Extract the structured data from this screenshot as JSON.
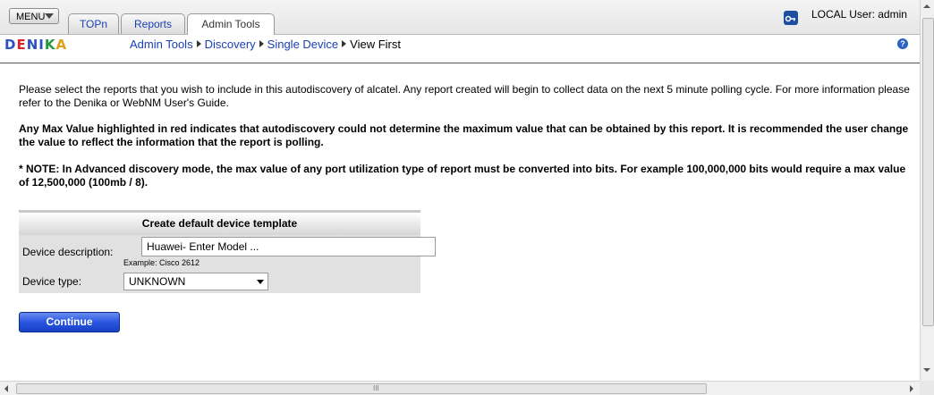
{
  "header": {
    "menu_label": "MENU",
    "tabs": [
      {
        "label": "TOPn"
      },
      {
        "label": "Reports"
      },
      {
        "label": "Admin Tools"
      }
    ],
    "user_label": "LOCAL User: admin",
    "lock_icon": "lock-icon"
  },
  "logo": {
    "letters": [
      "D",
      "E",
      "N",
      "I",
      "K",
      "A"
    ]
  },
  "breadcrumb": {
    "items": [
      "Admin Tools",
      "Discovery",
      "Single Device"
    ],
    "current": "View First",
    "help_icon": "?"
  },
  "content": {
    "para1": "Please select the reports that you wish to include in this autodiscovery of alcatel. Any report created will begin to collect data on the next 5 minute polling cycle. For more information please refer to the Denika or WebNM User's Guide.",
    "para2": "Any Max Value highlighted in red indicates that autodiscovery could not determine the maximum value that can be obtained by this report. It is recommended the user change the value to reflect the information that the report is polling.",
    "para3": "* NOTE: In Advanced discovery mode, the max value of any port utilization type of report must be converted into bits. For example 100,000,000 bits would require a max value of 12,500,000 (100mb / 8)."
  },
  "template_box": {
    "title": "Create default device template",
    "desc_label": "Device description:",
    "desc_value": "Huawei- Enter Model ...",
    "example": "Example: Cisco 2612",
    "type_label": "Device type:",
    "type_value": "UNKNOWN"
  },
  "continue_label": "Continue",
  "scrollbar_grip": "III",
  "colors": {
    "link": "#1a3fb5",
    "button": "#2a56e0",
    "logo": [
      "#2b50c8",
      "#d8232a",
      "#2b50c8",
      "#2b50c8",
      "#1f9a3a",
      "#e0a11a"
    ]
  }
}
